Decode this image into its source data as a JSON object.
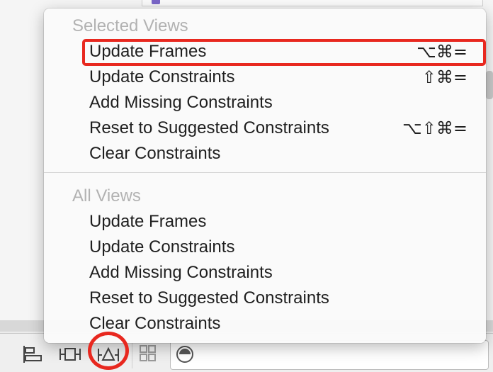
{
  "menu": {
    "selected_header": "Selected Views",
    "selected_items": [
      {
        "label": "Update Frames",
        "shortcut": "⌥⌘="
      },
      {
        "label": "Update Constraints",
        "shortcut": "⇧⌘="
      },
      {
        "label": "Add Missing Constraints",
        "shortcut": ""
      },
      {
        "label": "Reset to Suggested Constraints",
        "shortcut": "⌥⇧⌘="
      },
      {
        "label": "Clear Constraints",
        "shortcut": ""
      }
    ],
    "all_header": "All Views",
    "all_items": [
      {
        "label": "Update Frames"
      },
      {
        "label": "Update Constraints"
      },
      {
        "label": "Add Missing Constraints"
      },
      {
        "label": "Reset to Suggested Constraints"
      },
      {
        "label": "Clear Constraints"
      }
    ]
  },
  "toolbar": {
    "buttons": [
      "align-icon",
      "pin-icon",
      "resolve-auto-layout-icon",
      "size-class-icon",
      "filter-icon"
    ]
  },
  "annotations": {
    "highlight_color": "#e8281f"
  }
}
